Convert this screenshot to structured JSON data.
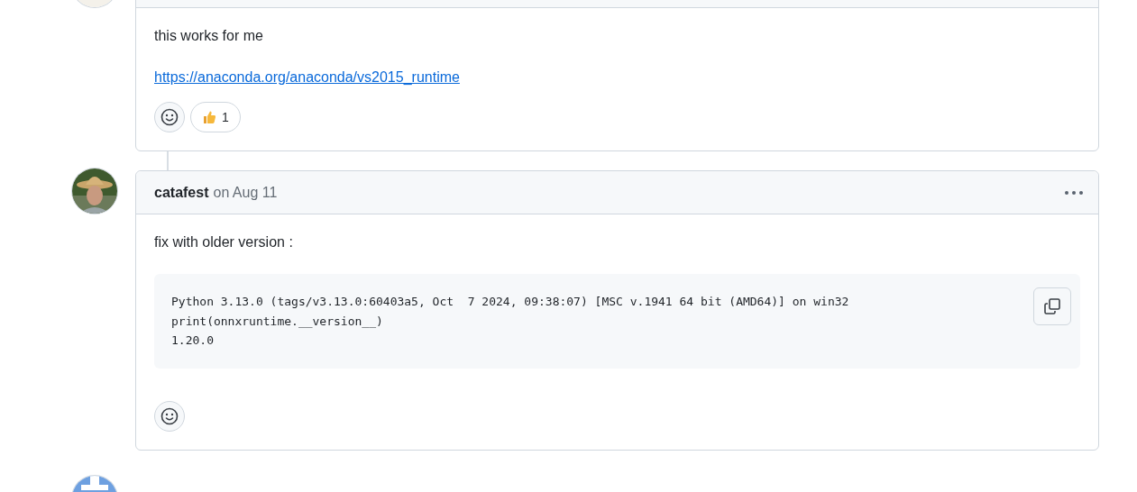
{
  "comments": [
    {
      "avatar": {
        "kind": "picture"
      },
      "body": [
        {
          "kind": "text",
          "text": "this works for me"
        },
        {
          "kind": "link",
          "text": "https://anaconda.org/anaconda/vs2015_runtime"
        }
      ],
      "reactions": [
        {
          "kind": "thumbs_up",
          "count": "1"
        }
      ]
    },
    {
      "avatar": {
        "kind": "picture"
      },
      "header": {
        "author": "catafest",
        "date": "on Aug 11"
      },
      "body": [
        {
          "kind": "text",
          "text": "fix with older version :"
        },
        {
          "kind": "code",
          "lines": [
            "Python 3.13.0 (tags/v3.13.0:60403a5, Oct  7 2024, 09:38:07) [MSC v.1941 64 bit (AMD64)] on win32",
            "print(onnxruntime.__version__)",
            "1.20.0"
          ]
        }
      ]
    },
    {
      "avatar": {
        "kind": "picture"
      }
    }
  ]
}
